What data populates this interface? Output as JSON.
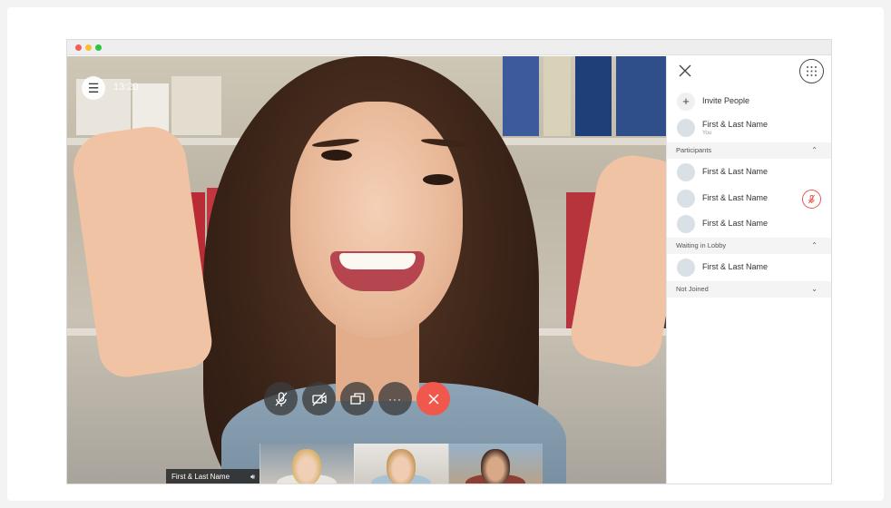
{
  "window": {
    "title_dots": [
      "close",
      "minimize",
      "maximize"
    ],
    "dot_colors": [
      "#f25f57",
      "#f9bf2f",
      "#29c840"
    ]
  },
  "video": {
    "time": "13:20",
    "menu_icon": "hamburger-icon",
    "controls": [
      {
        "name": "mute-microphone",
        "icon": "mic-off-icon"
      },
      {
        "name": "stop-video",
        "icon": "camera-off-icon"
      },
      {
        "name": "share-screen",
        "icon": "share-screen-icon"
      },
      {
        "name": "more-options",
        "icon": "more-icon",
        "label": "···"
      },
      {
        "name": "end-call",
        "icon": "close-icon",
        "color": "#f0574d"
      }
    ],
    "self_view_name": "First & Last Name"
  },
  "panel": {
    "invite": "Invite People",
    "self": {
      "name": "First & Last Name",
      "sub": "You"
    },
    "sections": {
      "participants": {
        "label": "Participants",
        "chevron": "⌃"
      },
      "lobby": {
        "label": "Waiting in Lobby",
        "chevron": "⌃"
      },
      "not_joined": {
        "label": "Not Joined",
        "chevron": "⌄"
      }
    },
    "participants": [
      {
        "name": "First & Last Name",
        "muted": false
      },
      {
        "name": "First & Last Name",
        "muted": true
      },
      {
        "name": "First & Last Name",
        "muted": false
      }
    ],
    "lobby": [
      {
        "name": "First & Last Name"
      }
    ],
    "accent_muted": "#e4584f"
  }
}
